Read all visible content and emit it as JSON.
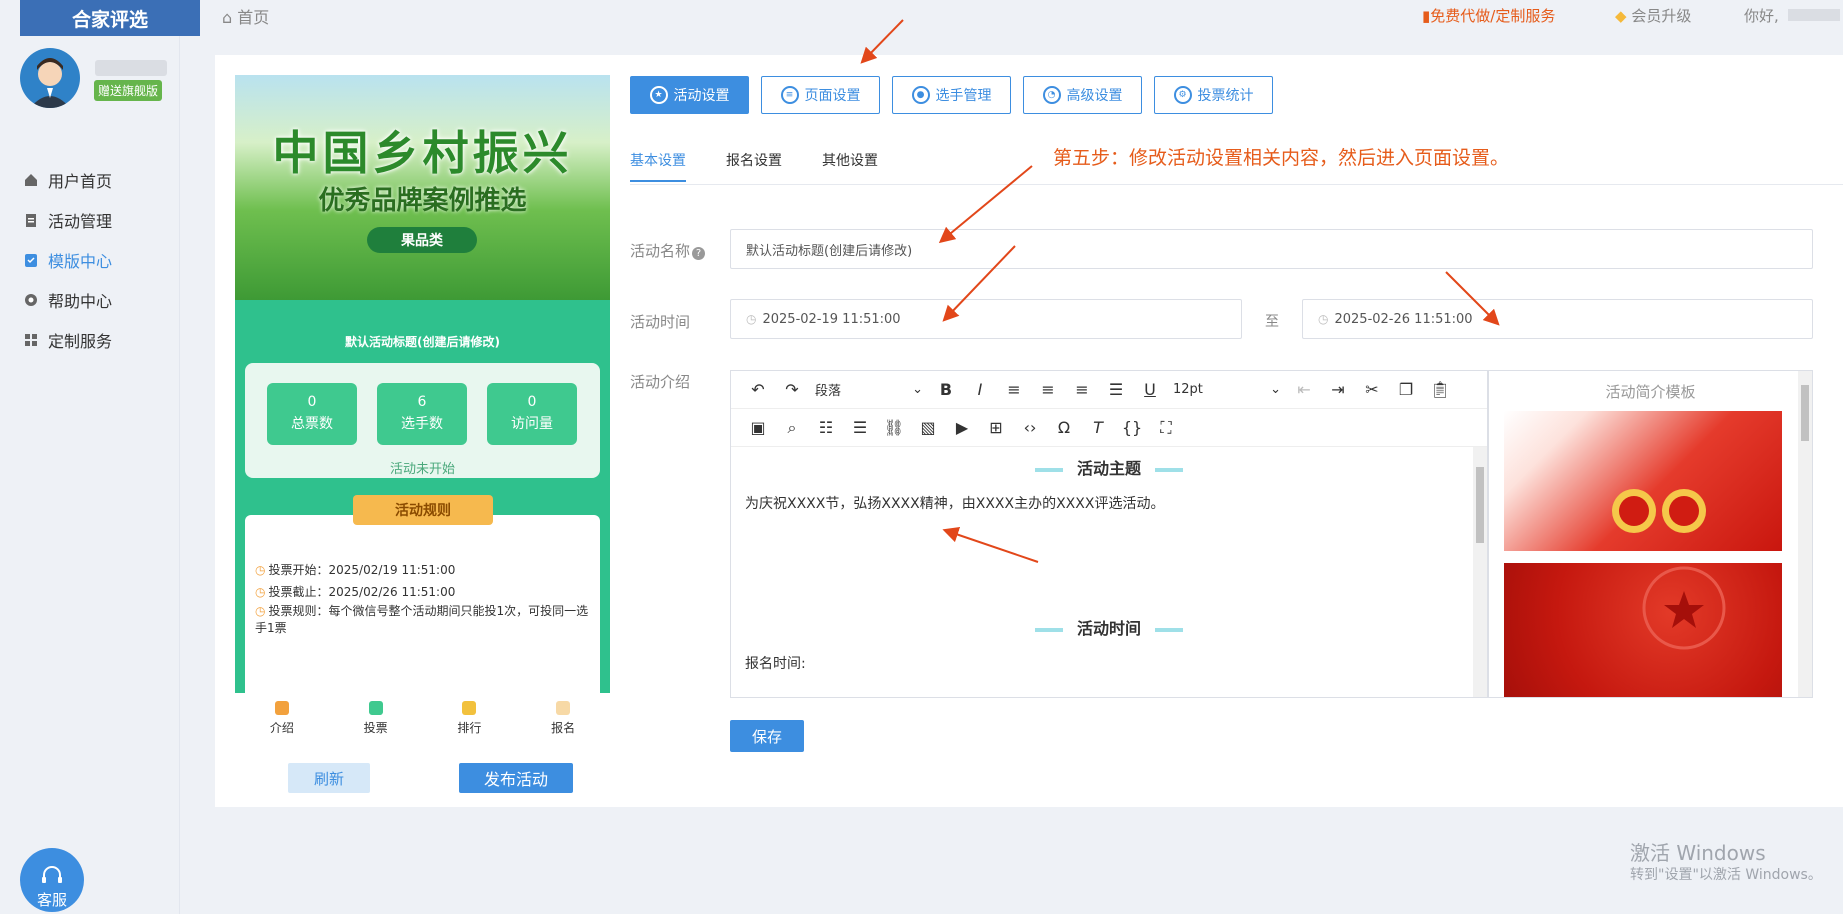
{
  "sidebar": {
    "logo": "合家评选",
    "badge": "赠送旗舰版",
    "items": [
      {
        "label": "用户首页",
        "icon": "home-icon"
      },
      {
        "label": "活动管理",
        "icon": "clipboard-icon"
      },
      {
        "label": "模版中心",
        "icon": "template-icon",
        "active": true
      },
      {
        "label": "帮助中心",
        "icon": "help-icon"
      },
      {
        "label": "定制服务",
        "icon": "grid-icon"
      }
    ],
    "service_label": "客服"
  },
  "topbar": {
    "breadcrumb": "首页",
    "free_service": "免费代做/定制服务",
    "vip_upgrade": "会员升级",
    "hello": "你好,"
  },
  "preview": {
    "banner_line1": "中国乡村振兴",
    "banner_line2": "优秀品牌案例推选",
    "banner_tag": "果品类",
    "title": "默认活动标题(创建后请修改)",
    "stats": [
      {
        "value": "0",
        "label": "总票数"
      },
      {
        "value": "6",
        "label": "选手数"
      },
      {
        "value": "0",
        "label": "访问量"
      }
    ],
    "state": "活动未开始",
    "rules_tag": "活动规则",
    "rules": [
      "投票开始：2025/02/19 11:51:00",
      "投票截止：2025/02/26 11:51:00",
      "投票规则：每个微信号整个活动期间只能投1次，可投同一选手1票"
    ],
    "nav": [
      "介绍",
      "投票",
      "排行",
      "报名"
    ],
    "refresh_label": "刷新",
    "publish_label": "发布活动"
  },
  "tabs": [
    "活动设置",
    "页面设置",
    "选手管理",
    "高级设置",
    "投票统计"
  ],
  "subtabs": [
    "基本设置",
    "报名设置",
    "其他设置"
  ],
  "step_note": "第五步：修改活动设置相关内容，然后进入页面设置。",
  "form": {
    "name_label": "活动名称",
    "name_value": "默认活动标题(创建后请修改)",
    "time_label": "活动时间",
    "start_time": "2025-02-19 11:51:00",
    "to": "至",
    "end_time": "2025-02-26 11:51:00",
    "intro_label": "活动介绍"
  },
  "editor": {
    "paragraph_select": "段落",
    "font_size": "12pt",
    "heading1": "活动主题",
    "body1": "为庆祝XXXX节，弘扬XXXX精神，由XXXX主办的XXXX评选活动。",
    "heading2": "活动时间",
    "body2": "报名时间:"
  },
  "template_panel": {
    "title": "活动简介模板"
  },
  "save_label": "保存",
  "watermark": {
    "line1": "激活 Windows",
    "line2": "转到\"设置\"以激活 Windows。"
  },
  "colors": {
    "primary": "#3d8ee0",
    "accent": "#e65c1b",
    "preview_green": "#2fc18d"
  }
}
